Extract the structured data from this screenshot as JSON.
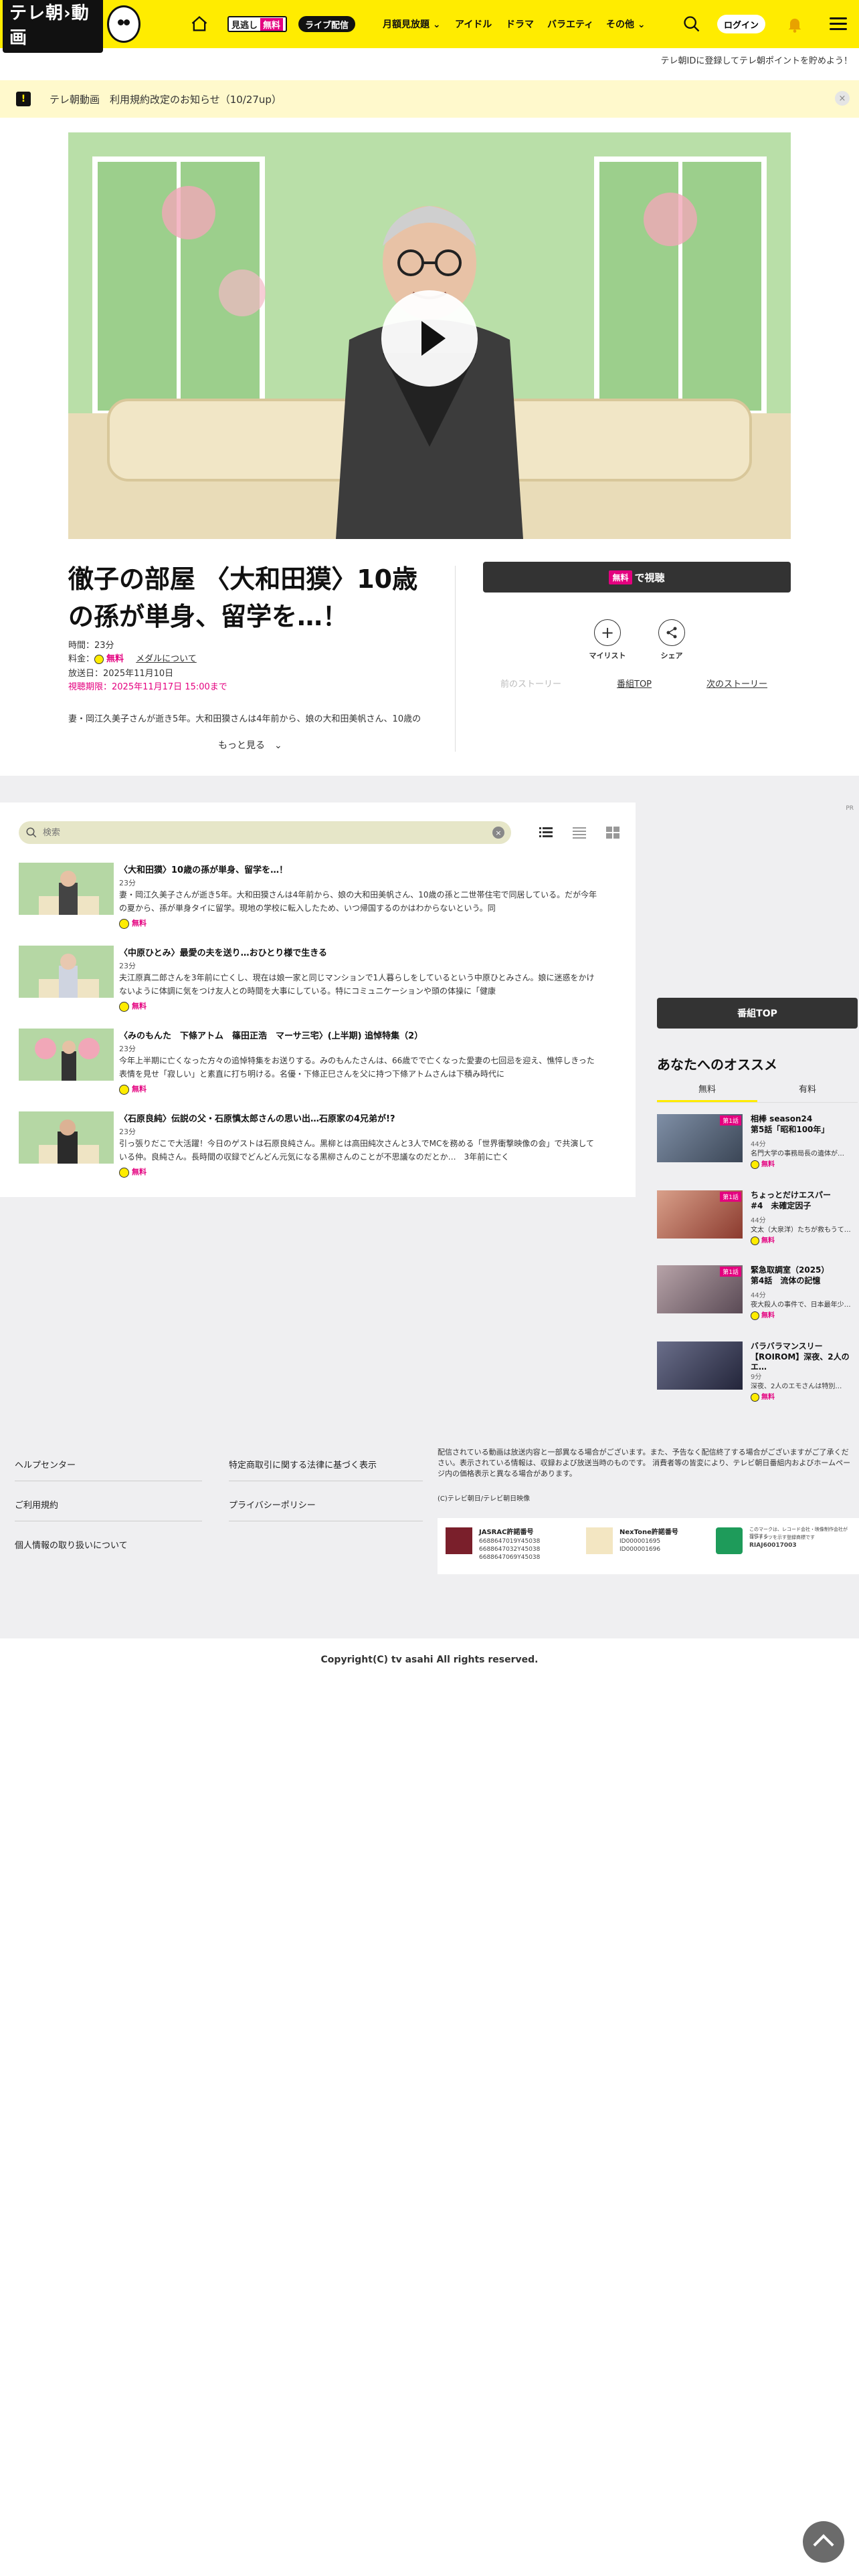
{
  "header": {
    "logo_text": "テレ朝",
    "logo_sub": "動画",
    "nav": {
      "mitsu_label": "見逃し",
      "mitsu_free": "無料",
      "live_label": "ライブ配信",
      "items": [
        "月額見放題",
        "アイドル",
        "ドラマ",
        "バラエティ",
        "その他"
      ]
    },
    "login_label": "ログイン",
    "promo_text": "テレ朝IDに登録してテレ朝ポイントを貯めよう！"
  },
  "notice": {
    "icon": "!",
    "text": "テレ朝動画　利用規約改定のお知らせ（10/27up）",
    "close": "×"
  },
  "program": {
    "title": "徹子の部屋 〈大和田獏〉10歳の孫が単身、留学を…！",
    "duration_label": "時間：23分",
    "price_label": "料金：",
    "price_value": "無料",
    "medal_link": "メダルについて",
    "broadcast_date": "放送日：2025年11月10日",
    "deadline": "視聴期限：2025年11月17日 15:00まで",
    "description": "妻・岡江久美子さんが逝き5年。大和田獏さんは4年前から、娘の大和田美帆さん、10歳の",
    "more_label": "もっと見る",
    "watch_free_tag": "無料",
    "watch_label": "で視聴",
    "mylist_label": "マイリスト",
    "share_label": "シェア",
    "prev_story": "前のストーリー",
    "program_top": "番組TOP",
    "next_story": "次のストーリー"
  },
  "episodes": {
    "search_placeholder": "検索",
    "items": [
      {
        "title": "〈大和田獏〉10歳の孫が単身、留学を…！",
        "duration": "23分",
        "desc": "妻・岡江久美子さんが逝き5年。大和田獏さんは4年前から、娘の大和田美帆さん、10歳の孫と二世帯住宅で同居している。だが今年の夏から、孫が単身タイに留学。現地の学校に転入したため、いつ帰国するのかはわからないという。同",
        "free": "無料"
      },
      {
        "title": "〈中原ひとみ〉最愛の夫を送り…おひとり様で生きる",
        "duration": "23分",
        "desc": "夫江原真二郎さんを3年前に亡くし、現在は娘一家と同じマンションで1人暮らしをしているという中原ひとみさん。娘に迷惑をかけないように体調に気をつけ友人との時間を大事にしている。特にコミュニケーションや頭の体操に「健康",
        "free": "無料"
      },
      {
        "title": "〈みのもんた　下條アトム　篠田正浩　マーサ三宅〉(上半期) 追悼特集（2）",
        "duration": "23分",
        "desc": "今年上半期に亡くなった方々の追悼特集をお送りする。みのもんたさんは、66歳でで亡くなった愛妻の七回忌を迎え、憔悴しきった表情を見せ「寂しい」と素直に打ち明ける。名優・下條正巳さんを父に持つ下條アトムさんは下積み時代に",
        "free": "無料"
      },
      {
        "title": "〈石原良純〉伝説の父・石原慎太郎さんの思い出…石原家の4兄弟が!?",
        "duration": "23分",
        "desc": "引っ張りだこで大活躍！今日のゲストは石原良純さん。黒柳とは高田純次さんと3人でMCを務める「世界衝撃映像の会」で共演している仲。良純さん。長時間の収録でどんどん元気になる黒柳さんのことが不思議なのだとか…　3年前に亡く",
        "free": "無料"
      }
    ]
  },
  "sidebar": {
    "ad_label": "PR",
    "program_top": "番組TOP",
    "reco_title": "あなたへのオススメ",
    "tabs": [
      "無料",
      "有料"
    ],
    "items": [
      {
        "badge": "第1話",
        "name": "相棒 season24",
        "sub": "第5話「昭和100年」",
        "dur": "44分",
        "desc": "名門大学の事務局長の遺体が…",
        "free": "無料"
      },
      {
        "badge": "第1話",
        "name": "ちょっとだけエスパー",
        "sub": "#4　未確定因子",
        "dur": "44分",
        "desc": "文太（大泉洋）たちが救もうて…",
        "free": "無料"
      },
      {
        "badge": "第1話",
        "name": "緊急取調室（2025）",
        "sub": "第4話　流体の記憶",
        "dur": "44分",
        "desc": "夜大殺人の事件で、日本最年少…",
        "free": "無料"
      },
      {
        "badge": "",
        "name": "バラバラマンスリー",
        "sub": "【ROIROM】深夜、2人のエ…",
        "dur": "9分",
        "desc": "深夜、2人のエモさんは特別…",
        "free": "無料"
      }
    ]
  },
  "footer": {
    "links_left": [
      "ヘルプセンター",
      "ご利用規約",
      "個人情報の取り扱いについて"
    ],
    "links_right": [
      "特定商取引に関する法律に基づく表示",
      "プライバシーポリシー"
    ],
    "note": "配信されている動画は放送内容と一部異なる場合がございます。また、予告なく配信終了する場合がございますがご了承ください。表示されている情報は、収録および放送当時のものです。\n消費者等の皆変により、テレビ朝日番組内およびホームページ内の価格表示と異なる場合があります。",
    "copy_small": "(C)テレビ朝日/テレビ朝日映像",
    "licences": [
      {
        "title": "JASRAC許諾番号",
        "nums": [
          "6688647019Y45038",
          "6688647032Y45038",
          "6688647069Y45038"
        ]
      },
      {
        "title": "NexTone許諾番号",
        "nums": [
          "ID000001695",
          "ID000001696"
        ]
      },
      {
        "title": "エルマーク",
        "nums": [
          "このマークは、レコード会社・映像制作会社が提供する",
          "コンテンツを示す登録商標です",
          "RIAJ60017003"
        ]
      }
    ],
    "copyright": "Copyright(C) tv asahi All rights reserved."
  }
}
